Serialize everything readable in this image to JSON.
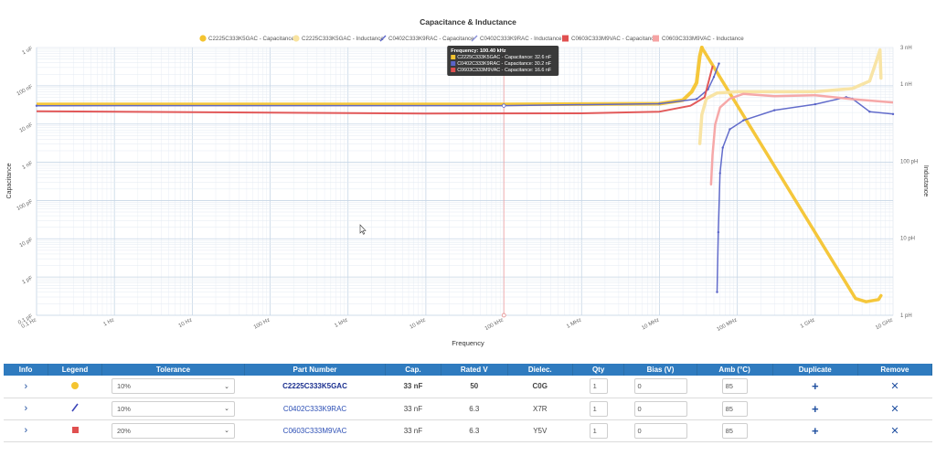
{
  "chart_data": {
    "type": "line",
    "title": "Capacitance & Inductance",
    "xlabel": "Frequency",
    "ylabel_left": "Capacitance",
    "ylabel_right": "Inductance",
    "x_scale": "log",
    "x_range_hz": [
      0.1,
      10000000000
    ],
    "x_ticks": [
      "0.1 Hz",
      "1 Hz",
      "10 Hz",
      "100 Hz",
      "1 kHz",
      "10 kHz",
      "100 kHz",
      "1 MHz",
      "10 MHz",
      "100 MHz",
      "1 GHz",
      "10 GHz"
    ],
    "y_left_scale": "log",
    "y_left_range_f": [
      1e-13,
      1e-06
    ],
    "y_left_ticks": [
      "0.1 pF",
      "1 pF",
      "10 pF",
      "100 pF",
      "1 nF",
      "10 nF",
      "100 nF",
      "1 uF"
    ],
    "y_right_scale": "log",
    "y_right_range_h": [
      1e-12,
      3e-09
    ],
    "y_right_ticks": [
      "1 pH",
      "10 pH",
      "100 pH",
      "1 nH",
      "3 nH"
    ],
    "grid": true,
    "legend_position": "top",
    "legend": [
      {
        "label": "C2225C333K5GAC - Capacitance",
        "color": "#f4c430",
        "marker": "circle"
      },
      {
        "label": "C2225C333K5GAC - Inductance",
        "color": "#f8e3a0",
        "marker": "circle"
      },
      {
        "label": "C0402C333K9RAC - Capacitance",
        "color": "#5a64c8",
        "marker": "line"
      },
      {
        "label": "C0402C333K9RAC - Inductance",
        "color": "#8a90d8",
        "marker": "line"
      },
      {
        "label": "C0603C333M9VAC - Capacitance",
        "color": "#e05050",
        "marker": "square"
      },
      {
        "label": "C0603C333M9VAC - Inductance",
        "color": "#f5a3a3",
        "marker": "square"
      }
    ],
    "series": [
      {
        "name": "C2225C333K5GAC - Capacitance",
        "axis": "left",
        "color": "#f4c430",
        "width": 4,
        "points": [
          [
            0.1,
            3.26e-08
          ],
          [
            100,
            3.26e-08
          ],
          [
            100000,
            3.26e-08
          ],
          [
            10000000,
            3.4e-08
          ],
          [
            20000000,
            4.2e-08
          ],
          [
            26000000,
            7e-08
          ],
          [
            30000000,
            1.2e-07
          ],
          [
            33000000,
            6e-07
          ],
          [
            35000000,
            1e-06
          ]
        ]
      },
      {
        "name": "C2225C333K5GAC - Inductance",
        "axis": "right",
        "color": "#f4c430",
        "width": 3.5,
        "points": [
          [
            35000000,
            3e-09
          ],
          [
            3300000000,
            1.65e-12
          ],
          [
            4500000000,
            1.5e-12
          ],
          [
            6500000000,
            1.6e-12
          ],
          [
            7000000000,
            1.8e-12
          ]
        ]
      },
      {
        "name": "C2225C333K5GAC - Inductance",
        "axis": "right",
        "color": "#f8e3a0",
        "width": 3.5,
        "points": [
          [
            33000000,
            1.7e-10
          ],
          [
            35000000,
            4e-10
          ],
          [
            40000000,
            6.5e-10
          ],
          [
            55000000,
            7.7e-10
          ],
          [
            100000000,
            8e-10
          ],
          [
            1000000000,
            8e-10
          ],
          [
            3000000000,
            8.8e-10
          ],
          [
            5000000000,
            1.1e-09
          ],
          [
            6300000000,
            2.2e-09
          ],
          [
            6800000000,
            2.8e-09
          ],
          [
            7000000000,
            1.2e-09
          ]
        ]
      },
      {
        "name": "C0402C333K9RAC - Capacitance",
        "axis": "left",
        "color": "#5a64c8",
        "width": 1.5,
        "markers": true,
        "points": [
          [
            0.1,
            3e-08
          ],
          [
            100000,
            3.02e-08
          ],
          [
            10000000,
            3.4e-08
          ],
          [
            30000000,
            4.5e-08
          ],
          [
            42000000,
            8e-08
          ],
          [
            50000000,
            1.7e-07
          ],
          [
            58000000,
            3.8e-07
          ]
        ]
      },
      {
        "name": "C0402C333K9RAC - Inductance",
        "axis": "right",
        "color": "#5a64c8",
        "width": 1.5,
        "markers": true,
        "points": [
          [
            55000000,
            2e-12
          ],
          [
            57000000,
            1.2e-11
          ],
          [
            60000000,
            7e-11
          ],
          [
            65000000,
            1.5e-10
          ],
          [
            80000000,
            2.6e-10
          ],
          [
            120000000,
            3.4e-10
          ],
          [
            300000000,
            4.6e-10
          ],
          [
            1000000000,
            5.5e-10
          ],
          [
            2500000000,
            6.8e-10
          ],
          [
            3000000000,
            6.5e-10
          ],
          [
            5000000000,
            4.4e-10
          ],
          [
            10000000000,
            4.1e-10
          ]
        ]
      },
      {
        "name": "C0603C333M9VAC - Capacitance",
        "axis": "left",
        "color": "#e05050",
        "width": 2,
        "points": [
          [
            0.1,
            2.15e-08
          ],
          [
            10,
            2.05e-08
          ],
          [
            10000,
            1.88e-08
          ],
          [
            1000000,
            1.9e-08
          ],
          [
            10000000,
            2.1e-08
          ],
          [
            25000000,
            3e-08
          ],
          [
            38000000,
            5e-08
          ],
          [
            42000000,
            1.1e-07
          ],
          [
            48000000,
            3.2e-07
          ]
        ]
      },
      {
        "name": "C0603C333M9VAC - Inductance",
        "axis": "right",
        "color": "#f5a3a3",
        "width": 2.5,
        "points": [
          [
            46000000,
            5e-11
          ],
          [
            48000000,
            1.2e-10
          ],
          [
            52000000,
            3e-10
          ],
          [
            60000000,
            5e-10
          ],
          [
            80000000,
            6.5e-10
          ],
          [
            120000000,
            7.5e-10
          ],
          [
            300000000,
            7e-10
          ],
          [
            1000000000,
            7.2e-10
          ],
          [
            3000000000,
            6.4e-10
          ],
          [
            10000000000,
            5.8e-10
          ]
        ]
      }
    ],
    "cursor": {
      "frequency_hz": 100400
    },
    "tooltip": {
      "title": "Frequency: 100.40 kHz",
      "rows": [
        {
          "text": "C2225C333K5GAC - Capacitance: 32.6 nF",
          "color": "#f4c430"
        },
        {
          "text": "C0402C333K9RAC - Capacitance: 30.2 nF",
          "color": "#5a64c8"
        },
        {
          "text": "C0603C333M9VAC - Capacitance: 16.6 nF",
          "color": "#e05050"
        }
      ]
    }
  },
  "table": {
    "headers": [
      "Info",
      "Legend",
      "Tolerance",
      "Part Number",
      "Cap.",
      "Rated V",
      "Dielec.",
      "Qty",
      "Bias (V)",
      "Amb (°C)",
      "Duplicate",
      "Remove"
    ],
    "rows": [
      {
        "legend_shape": "circle",
        "legend_color": "#f4c430",
        "tolerance": "10%",
        "part_number": "C2225C333K5GAC",
        "cap": "33 nF",
        "rated_v": "50",
        "dielectric": "C0G",
        "qty": "1",
        "bias": "0",
        "amb": "85",
        "emphasis": true
      },
      {
        "legend_shape": "line",
        "legend_color": "#3b45b8",
        "tolerance": "10%",
        "part_number": "C0402C333K9RAC",
        "cap": "33 nF",
        "rated_v": "6.3",
        "dielectric": "X7R",
        "qty": "1",
        "bias": "0",
        "amb": "85",
        "emphasis": false
      },
      {
        "legend_shape": "square",
        "legend_color": "#e05050",
        "tolerance": "20%",
        "part_number": "C0603C333M9VAC",
        "cap": "33 nF",
        "rated_v": "6.3",
        "dielectric": "Y5V",
        "qty": "1",
        "bias": "0",
        "amb": "85",
        "emphasis": false
      }
    ],
    "icons": {
      "info": "chevron-right-icon",
      "dropdown": "chevron-down-icon",
      "duplicate": "plus-icon",
      "remove": "close-icon"
    }
  }
}
